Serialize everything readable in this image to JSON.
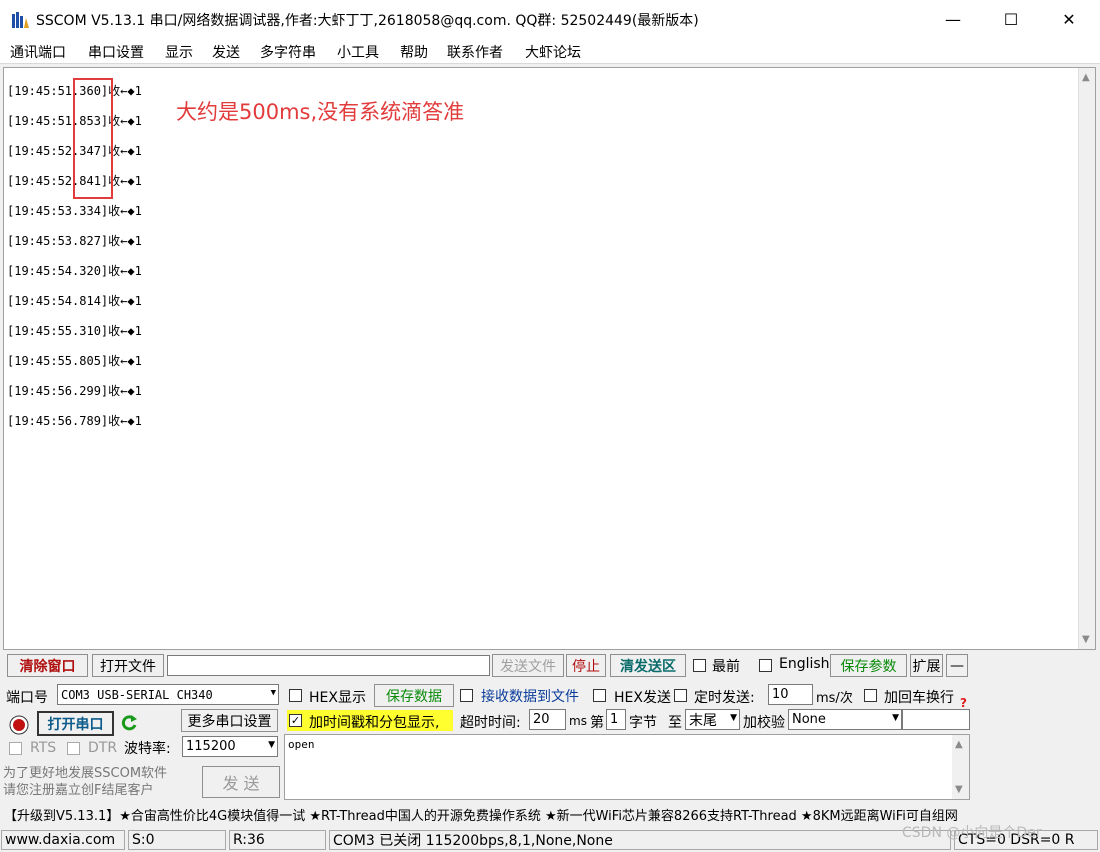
{
  "window": {
    "title": "SSCOM V5.13.1 串口/网络数据调试器,作者:大虾丁丁,2618058@qq.com. QQ群:  52502449(最新版本)",
    "min": "—",
    "max": "☐",
    "close": "✕"
  },
  "menu": [
    "通讯端口",
    "串口设置",
    "显示",
    "发送",
    "多字符串",
    "小工具",
    "帮助",
    "联系作者",
    "大虾论坛"
  ],
  "receive": {
    "lines": [
      "[19:45:51.360]收←◆1",
      "[19:45:51.853]收←◆1",
      "[19:45:52.347]收←◆1",
      "[19:45:52.841]收←◆1",
      "[19:45:53.334]收←◆1",
      "[19:45:53.827]收←◆1",
      "[19:45:54.320]收←◆1",
      "[19:45:54.814]收←◆1",
      "[19:45:55.310]收←◆1",
      "[19:45:55.805]收←◆1",
      "[19:45:56.299]收←◆1",
      "[19:45:56.789]收←◆1"
    ],
    "annotation": "大约是500ms,没有系统滴答准"
  },
  "toolbar": {
    "clear_window": "清除窗口",
    "open_file": "打开文件",
    "send_file": "发送文件",
    "stop": "停止",
    "clear_send": "清发送区",
    "topmost": "最前",
    "english": "English",
    "save_params": "保存参数",
    "expand": "扩展",
    "collapse": "—"
  },
  "port": {
    "label": "端口号",
    "value": "COM3 USB-SERIAL CH340",
    "open_button": "打开串口",
    "more_settings": "更多串口设置",
    "rts": "RTS",
    "dtr": "DTR",
    "baud_label": "波特率:",
    "baud_value": "115200"
  },
  "options": {
    "hex_display": "HEX显示",
    "save_data": "保存数据",
    "recv_to_file": "接收数据到文件",
    "hex_send": "HEX发送",
    "timed_send": "定时发送:",
    "interval": "10",
    "interval_unit": "ms/次",
    "add_newline": "加回车换行",
    "timestamp": "加时间戳和分包显示,",
    "timeout_label": "超时时间:",
    "timeout_value": "20",
    "timeout_unit": "ms",
    "byte_prefix": "第",
    "byte_value": "1",
    "byte_suffix": "字节",
    "to_label": "至",
    "end_value": "末尾",
    "checksum_label": "加校验",
    "checksum_value": "None",
    "help": "?"
  },
  "send": {
    "hint": "为了更好地发展SSCOM软件\n请您注册嘉立创F结尾客户",
    "button": "发  送",
    "text": "open"
  },
  "ticker": "【升级到V5.13.1】★合宙高性价比4G模块值得一试 ★RT-Thread中国人的开源免费操作系统 ★新一代WiFi芯片兼容8266支持RT-Thread ★8KM远距离WiFi可自组网",
  "status": {
    "website": "www.daxia.com",
    "sent": "S:0",
    "received": "R:36",
    "port_state": "COM3 已关闭  115200bps,8,1,None,None",
    "lines": "CTS=0 DSR=0 R"
  },
  "watermark": "CSDN @小向是个Der"
}
